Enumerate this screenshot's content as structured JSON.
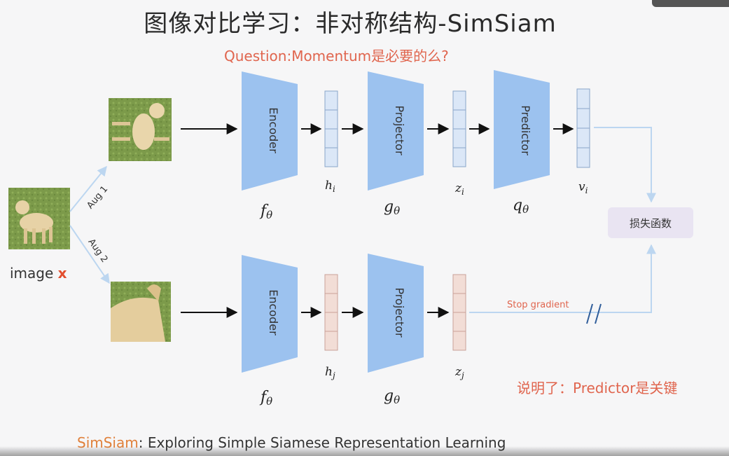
{
  "title": "图像对比学习：非对称结构-SimSiam",
  "question": "Question:Momentum是必要的么?",
  "conclusion": "说明了：Predictor是关键",
  "footer": {
    "brand": "SimSiam",
    "rest": ":  Exploring Simple Siamese Representation Learning"
  },
  "input": {
    "label": "image",
    "var": "x"
  },
  "augs": [
    "Aug 1",
    "Aug 2"
  ],
  "blocks": {
    "encoder": "Encoder",
    "projector": "Projector",
    "predictor": "Predictor"
  },
  "math": {
    "f": "f",
    "g": "g",
    "q": "q",
    "theta": "θ"
  },
  "vectors": {
    "h": "h",
    "z": "z",
    "v": "v",
    "i": "i",
    "j": "j"
  },
  "loss": "损失函数",
  "stop_gradient": "Stop gradient",
  "colors": {
    "accent": "#e0654e",
    "block": "#9cc2ef",
    "vec_top": "#dbe7f7",
    "vec_bottom": "#f2ddd6",
    "flow_line": "#bcd6f0"
  }
}
